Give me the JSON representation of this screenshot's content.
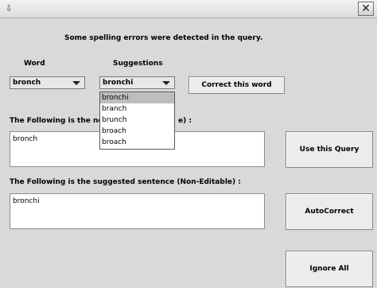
{
  "window": {
    "title": "",
    "close_glyph": "✕",
    "sys_glyph": "⇩"
  },
  "header": {
    "message": "Some spelling errors were detected in the query."
  },
  "word": {
    "label": "Word",
    "selected": "bronch"
  },
  "suggestions": {
    "label": "Suggestions",
    "selected": "bronchi",
    "options": [
      "bronchi",
      "branch",
      "brunch",
      "broach",
      "broach"
    ]
  },
  "buttons": {
    "correct_word": "Correct this word",
    "use_query": "Use this Query",
    "autocorrect": "AutoCorrect",
    "ignore_all": "Ignore All"
  },
  "editable": {
    "label_left": "The Following is the ne",
    "label_right": "e) :",
    "value": "bronch"
  },
  "suggested": {
    "label": "The Following is the suggested sentence (Non-Editable) :",
    "value": "bronchi"
  }
}
